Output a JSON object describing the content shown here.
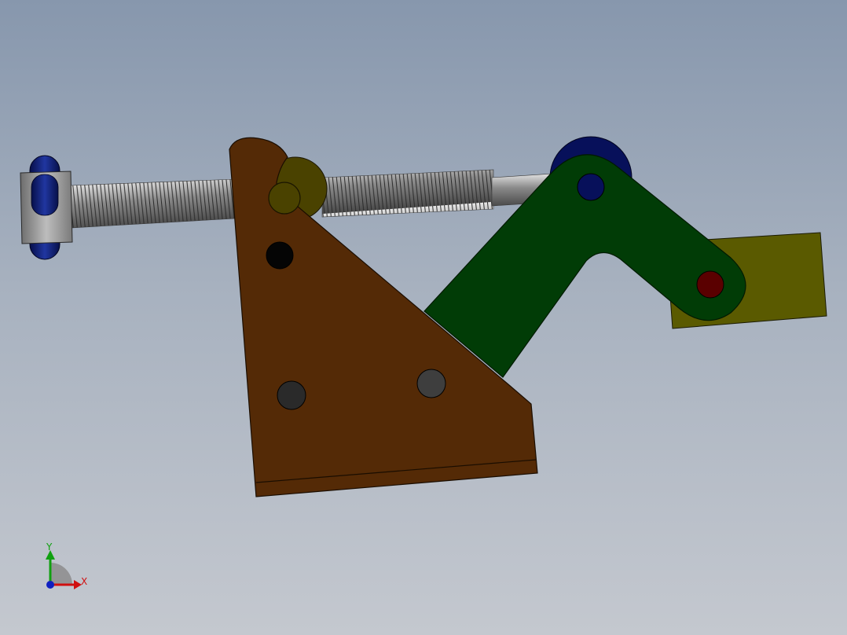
{
  "viewport": {
    "background_top": "#8797ad",
    "background_bottom": "#c4c8cf"
  },
  "model": {
    "parts": [
      {
        "name": "base-bracket",
        "color": "#542a06"
      },
      {
        "name": "clamp-arm",
        "color": "#013c06"
      },
      {
        "name": "clamp-pad",
        "color": "#5a5a00"
      },
      {
        "name": "threaded-rod",
        "color": "#8a8a8a"
      },
      {
        "name": "pivot-bushing",
        "color": "#4a4200"
      },
      {
        "name": "end-knob",
        "color": "#0d1a6b"
      },
      {
        "name": "handle-block",
        "color": "#9a9a9a"
      },
      {
        "name": "pin-dark-red",
        "color": "#5a0000"
      },
      {
        "name": "pin-navy",
        "color": "#07105a"
      }
    ]
  },
  "triad": {
    "x_label": "X",
    "y_label": "Y",
    "x_color": "#d01010",
    "y_color": "#10a010",
    "z_color": "#1020c0"
  }
}
